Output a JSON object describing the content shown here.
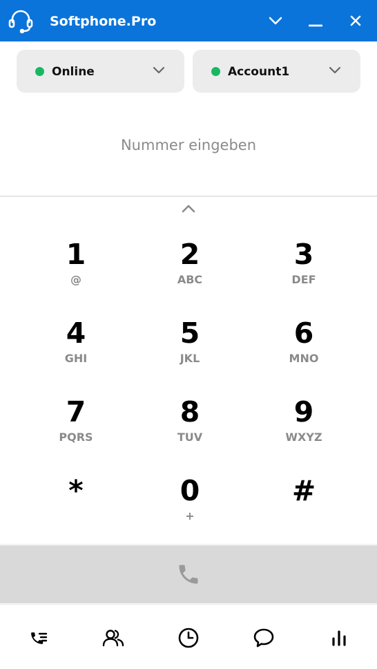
{
  "app": {
    "title": "Softphone.Pro",
    "brand_color": "#0a74da",
    "icons": {
      "logo": "headset-icon",
      "dropdown": "chevron-down-icon",
      "minimize": "minimize-icon",
      "close": "close-icon"
    }
  },
  "status_select": {
    "value": "Online",
    "status_color": "#18b862"
  },
  "account_select": {
    "value": "Account1",
    "status_color": "#18b862"
  },
  "number_input": {
    "placeholder": "Nummer eingeben",
    "value": ""
  },
  "keypad": {
    "keys": [
      {
        "digit": "1",
        "letters": "@"
      },
      {
        "digit": "2",
        "letters": "ABC"
      },
      {
        "digit": "3",
        "letters": "DEF"
      },
      {
        "digit": "4",
        "letters": "GHI"
      },
      {
        "digit": "5",
        "letters": "JKL"
      },
      {
        "digit": "6",
        "letters": "MNO"
      },
      {
        "digit": "7",
        "letters": "PQRS"
      },
      {
        "digit": "8",
        "letters": "TUV"
      },
      {
        "digit": "9",
        "letters": "WXYZ"
      },
      {
        "digit": "*",
        "letters": ""
      },
      {
        "digit": "0",
        "letters": "+"
      },
      {
        "digit": "#",
        "letters": ""
      }
    ]
  },
  "call_button": {
    "icon": "phone-icon",
    "color": "#9a9a9a"
  },
  "bottom_nav": [
    {
      "icon": "call-list-icon",
      "active": true
    },
    {
      "icon": "contacts-icon",
      "active": false
    },
    {
      "icon": "history-icon",
      "active": false
    },
    {
      "icon": "chat-icon",
      "active": false
    },
    {
      "icon": "stats-icon",
      "active": false
    }
  ]
}
